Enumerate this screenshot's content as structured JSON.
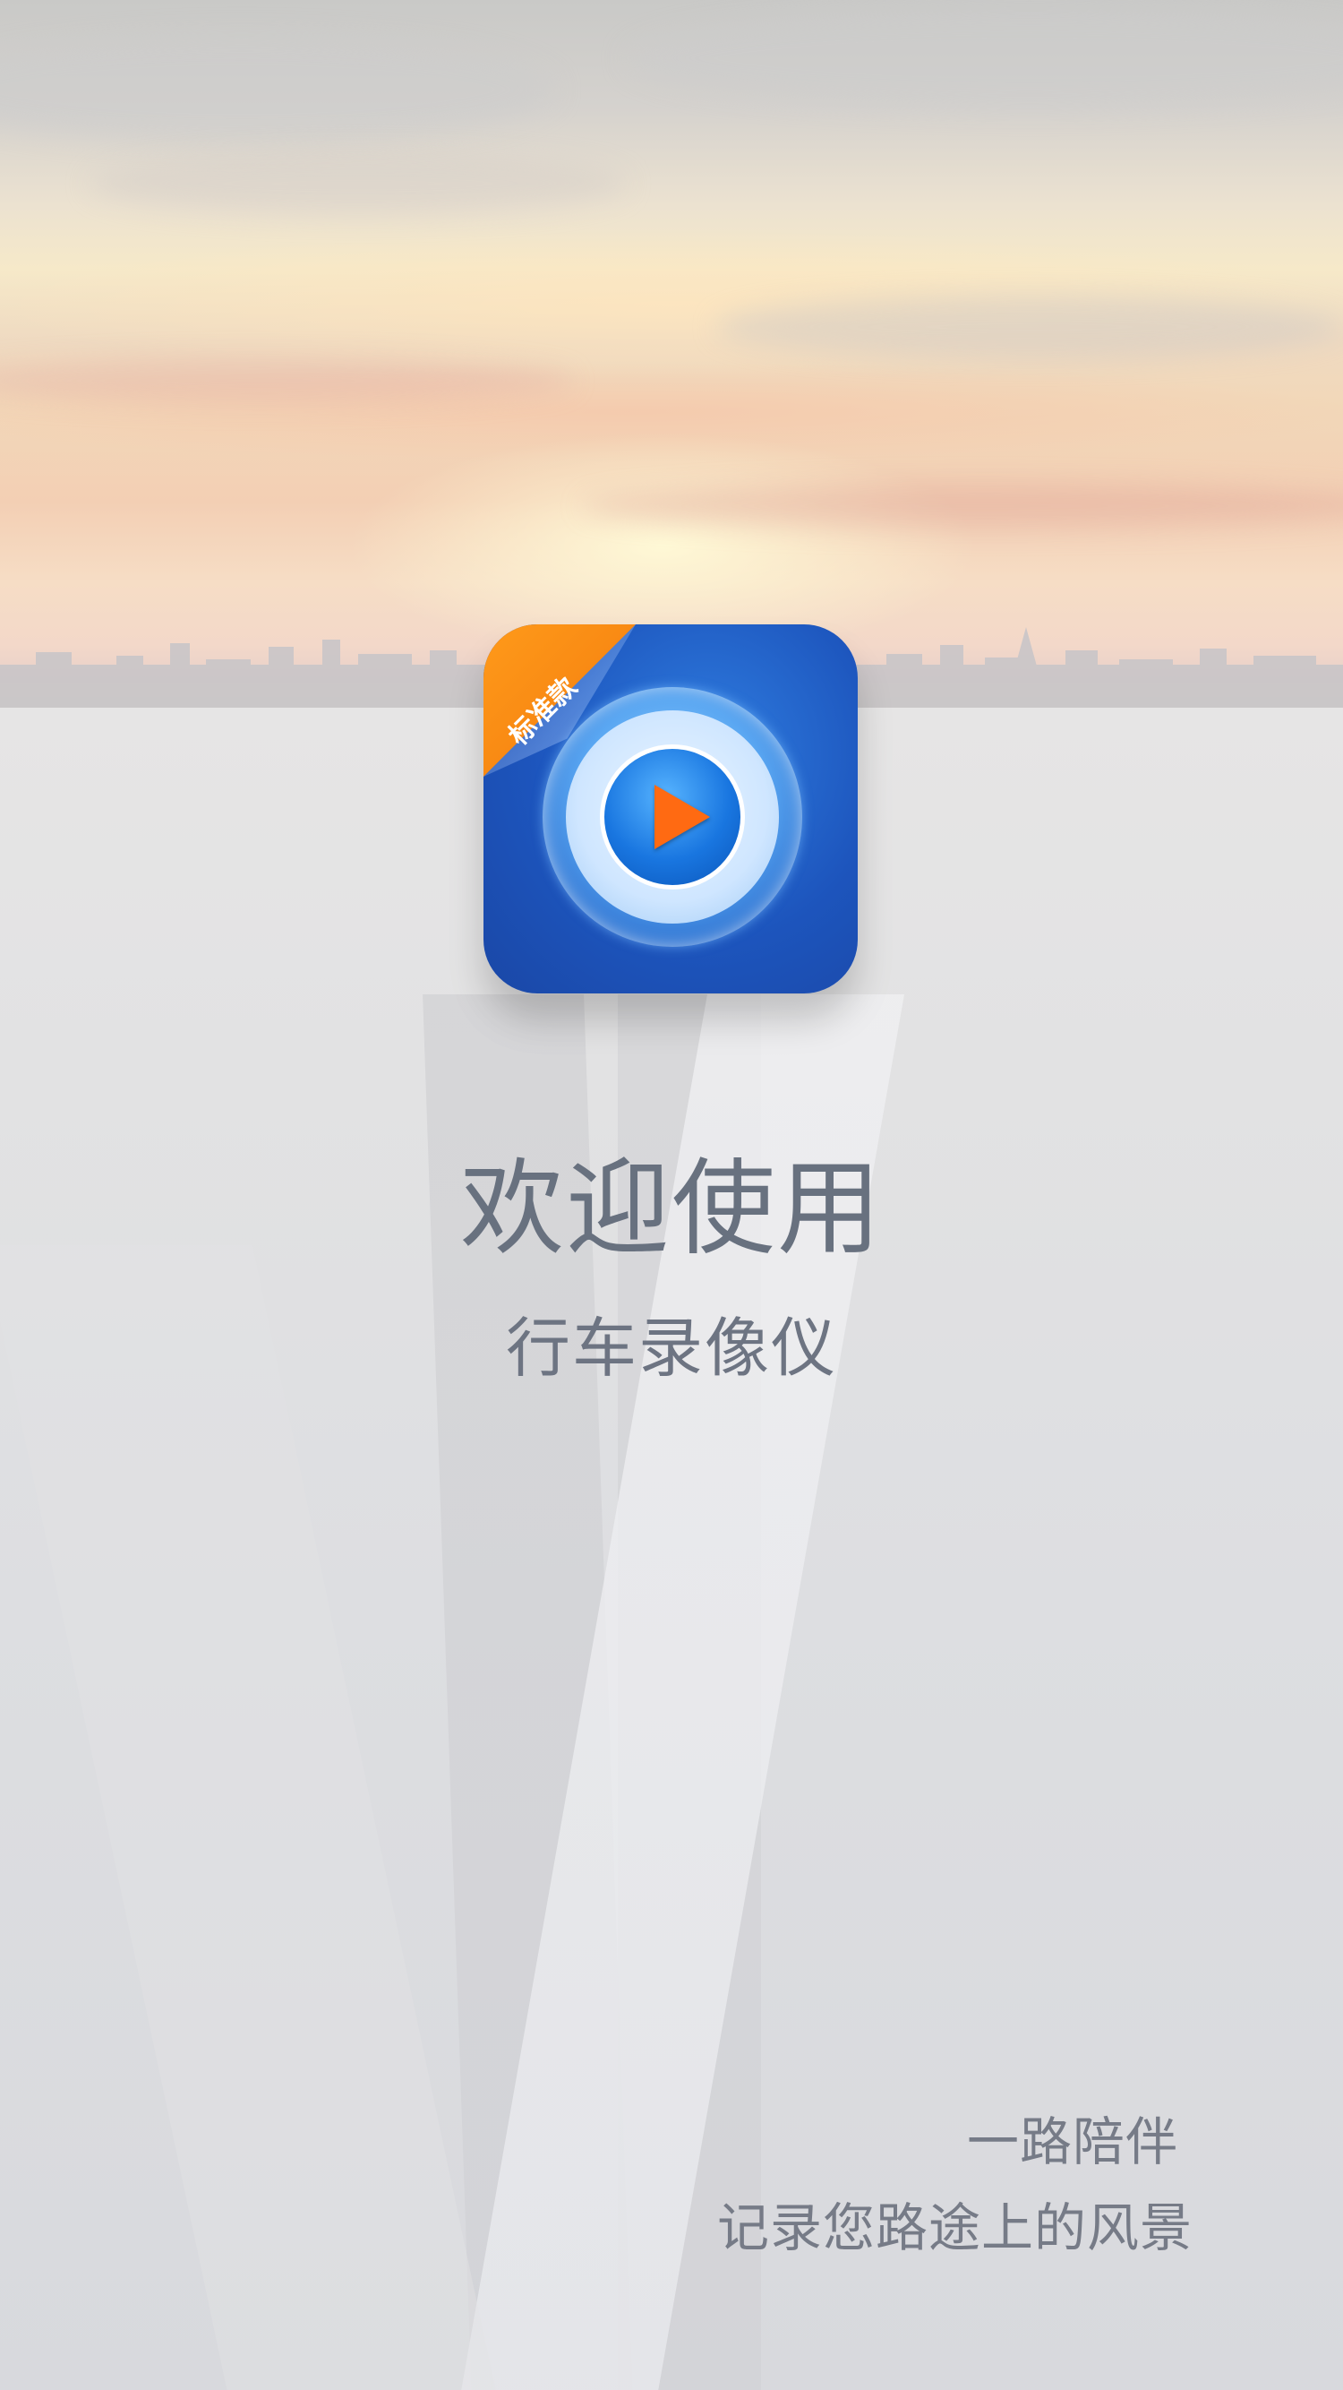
{
  "splash": {
    "badge_label": "标准款",
    "title": "欢迎使用",
    "app_name": "行车录像仪",
    "tagline_line1": "一路陪伴",
    "tagline_line2": "记录您路途上的风景"
  },
  "icons": {
    "app_icon": "app-logo-icon",
    "play": "play-icon"
  },
  "colors": {
    "icon_blue": "#1d55bd",
    "ribbon_orange": "#f27a0d",
    "play_orange": "#ff6a12",
    "text_gray": "#68717f"
  }
}
